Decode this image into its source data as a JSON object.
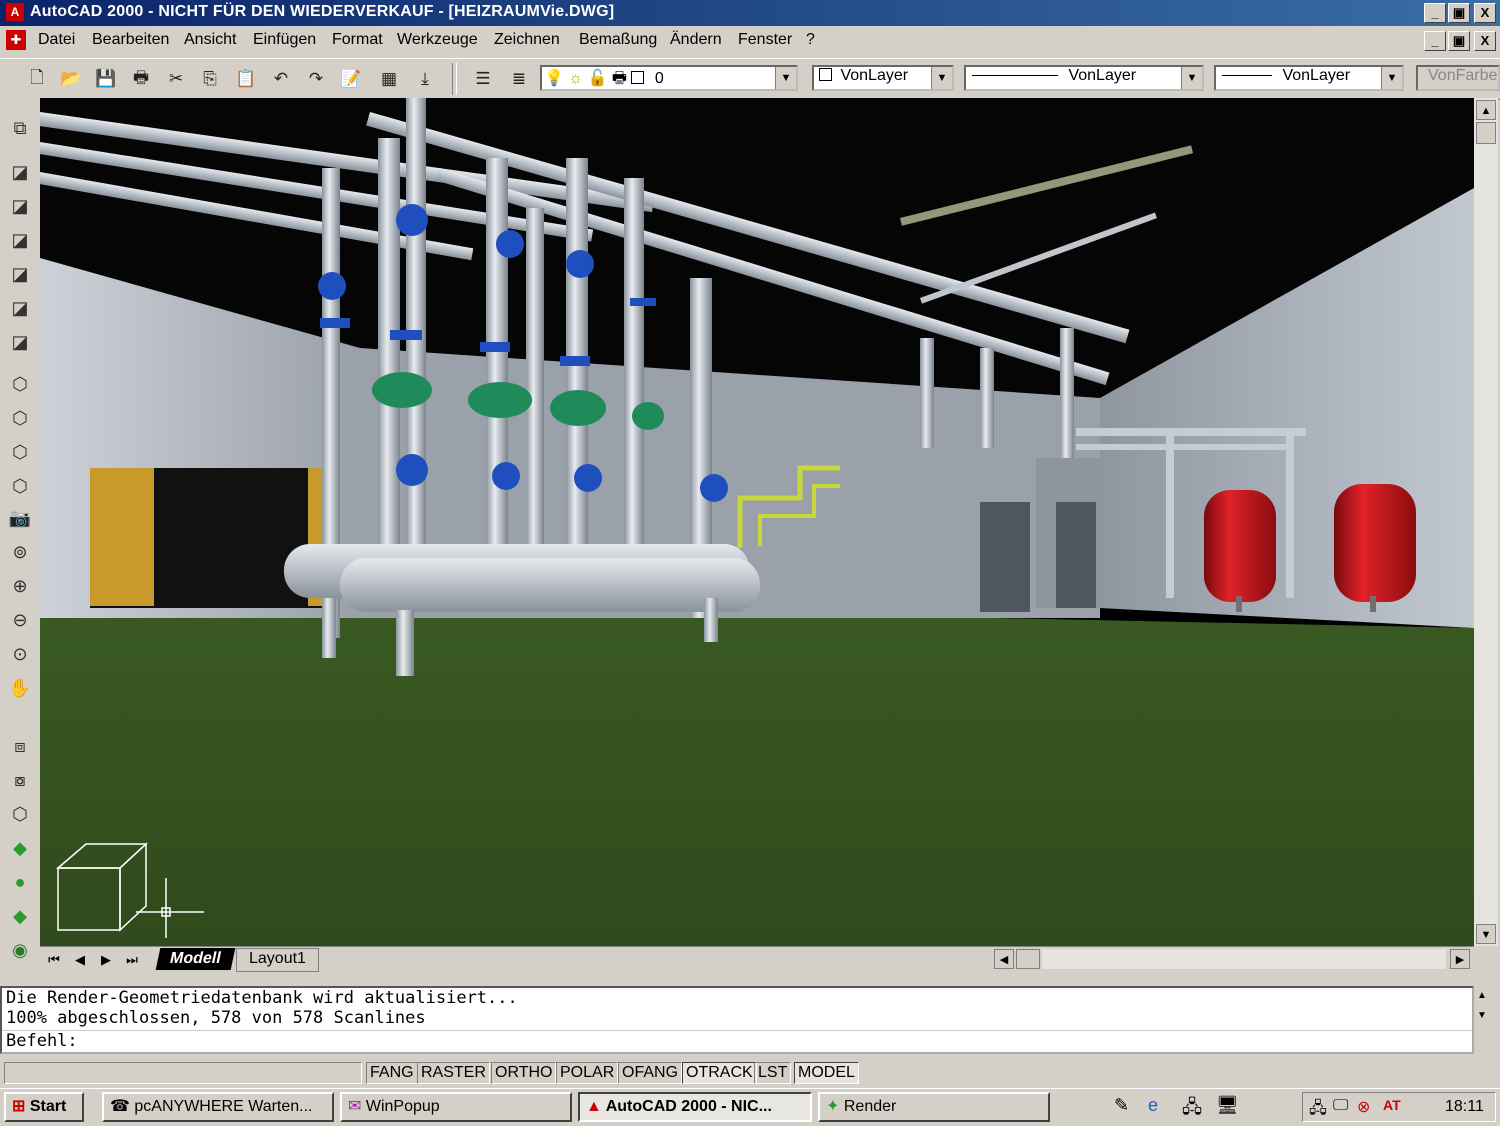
{
  "window": {
    "title": "AutoCAD 2000 - NICHT FÜR DEN WIEDERVERKAUF - [HEIZRAUMVie.DWG]",
    "minimize": "_",
    "restore": "▣",
    "close": "X"
  },
  "menu": [
    "Datei",
    "Bearbeiten",
    "Ansicht",
    "Einfügen",
    "Format",
    "Werkzeuge",
    "Zeichnen",
    "Bemaßung",
    "Ändern",
    "Fenster",
    "?"
  ],
  "toolbar": {
    "layer_value": "0",
    "color_value": "VonLayer",
    "linetype_value": "VonLayer",
    "lineweight_value": "VonLayer",
    "plotstyle_value": "VonFarbe"
  },
  "tabs": {
    "model": "Modell",
    "layout": "Layout1"
  },
  "command": {
    "line1": "Die Render-Geometriedatenbank wird aktualisiert...",
    "line2": "100% abgeschlossen, 578 von 578 Scanlines",
    "prompt": "Befehl:"
  },
  "status": [
    "FANG",
    "RASTER",
    "ORTHO",
    "POLAR",
    "OFANG",
    "OTRACK",
    "LST",
    "MODEL"
  ],
  "taskbar": {
    "start": "Start",
    "tasks": [
      "pcANYWHERE Warten...",
      "WinPopup",
      "AutoCAD 2000 - NIC...",
      "Render"
    ],
    "clock": "18:11"
  },
  "colors": {
    "titlebar": "#0a246a",
    "floor": "#3e5a24",
    "valves": "#1f4fbf",
    "pumps": "#1f8a5a",
    "tanks": "#c8141a"
  }
}
